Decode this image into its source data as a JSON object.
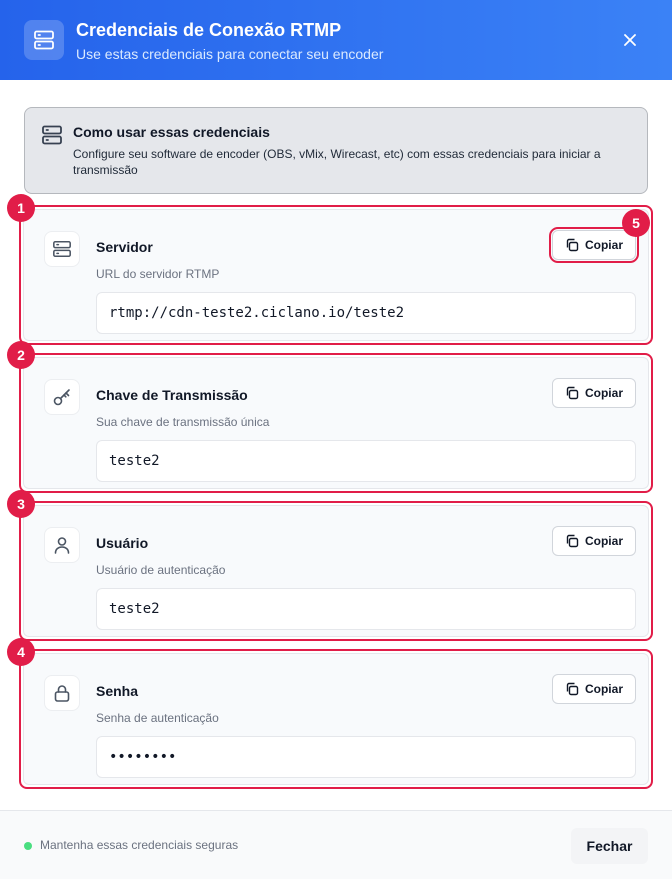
{
  "header": {
    "title": "Credenciais de Conexão RTMP",
    "subtitle": "Use estas credenciais para conectar seu encoder",
    "icon": "server-icon",
    "close_icon": "close-icon"
  },
  "info": {
    "title": "Como usar essas credenciais",
    "text": "Configure seu software de encoder (OBS, vMix, Wirecast, etc) com essas credenciais para iniciar a transmissão"
  },
  "fields": [
    {
      "badge": "1",
      "icon": "server-icon",
      "title": "Servidor",
      "description": "URL do servidor RTMP",
      "value": "rtmp://cdn-teste2.ciclano.io/teste2",
      "copy_label": "Copiar"
    },
    {
      "badge": "2",
      "icon": "key-icon",
      "title": "Chave de Transmissão",
      "description": "Sua chave de transmissão única",
      "value": "teste2",
      "copy_label": "Copiar"
    },
    {
      "badge": "3",
      "icon": "user-icon",
      "title": "Usuário",
      "description": "Usuário de autenticação",
      "value": "teste2",
      "copy_label": "Copiar"
    },
    {
      "badge": "4",
      "icon": "lock-icon",
      "title": "Senha",
      "description": "Senha de autenticação",
      "value": "••••••••",
      "copy_label": "Copiar"
    }
  ],
  "copy_badge": "5",
  "footer": {
    "status_text": "Mantenha essas credenciais seguras",
    "close_label": "Fechar"
  },
  "colors": {
    "accent": "#2563eb",
    "highlight": "#e11d48",
    "status_ok": "#4ade80"
  }
}
